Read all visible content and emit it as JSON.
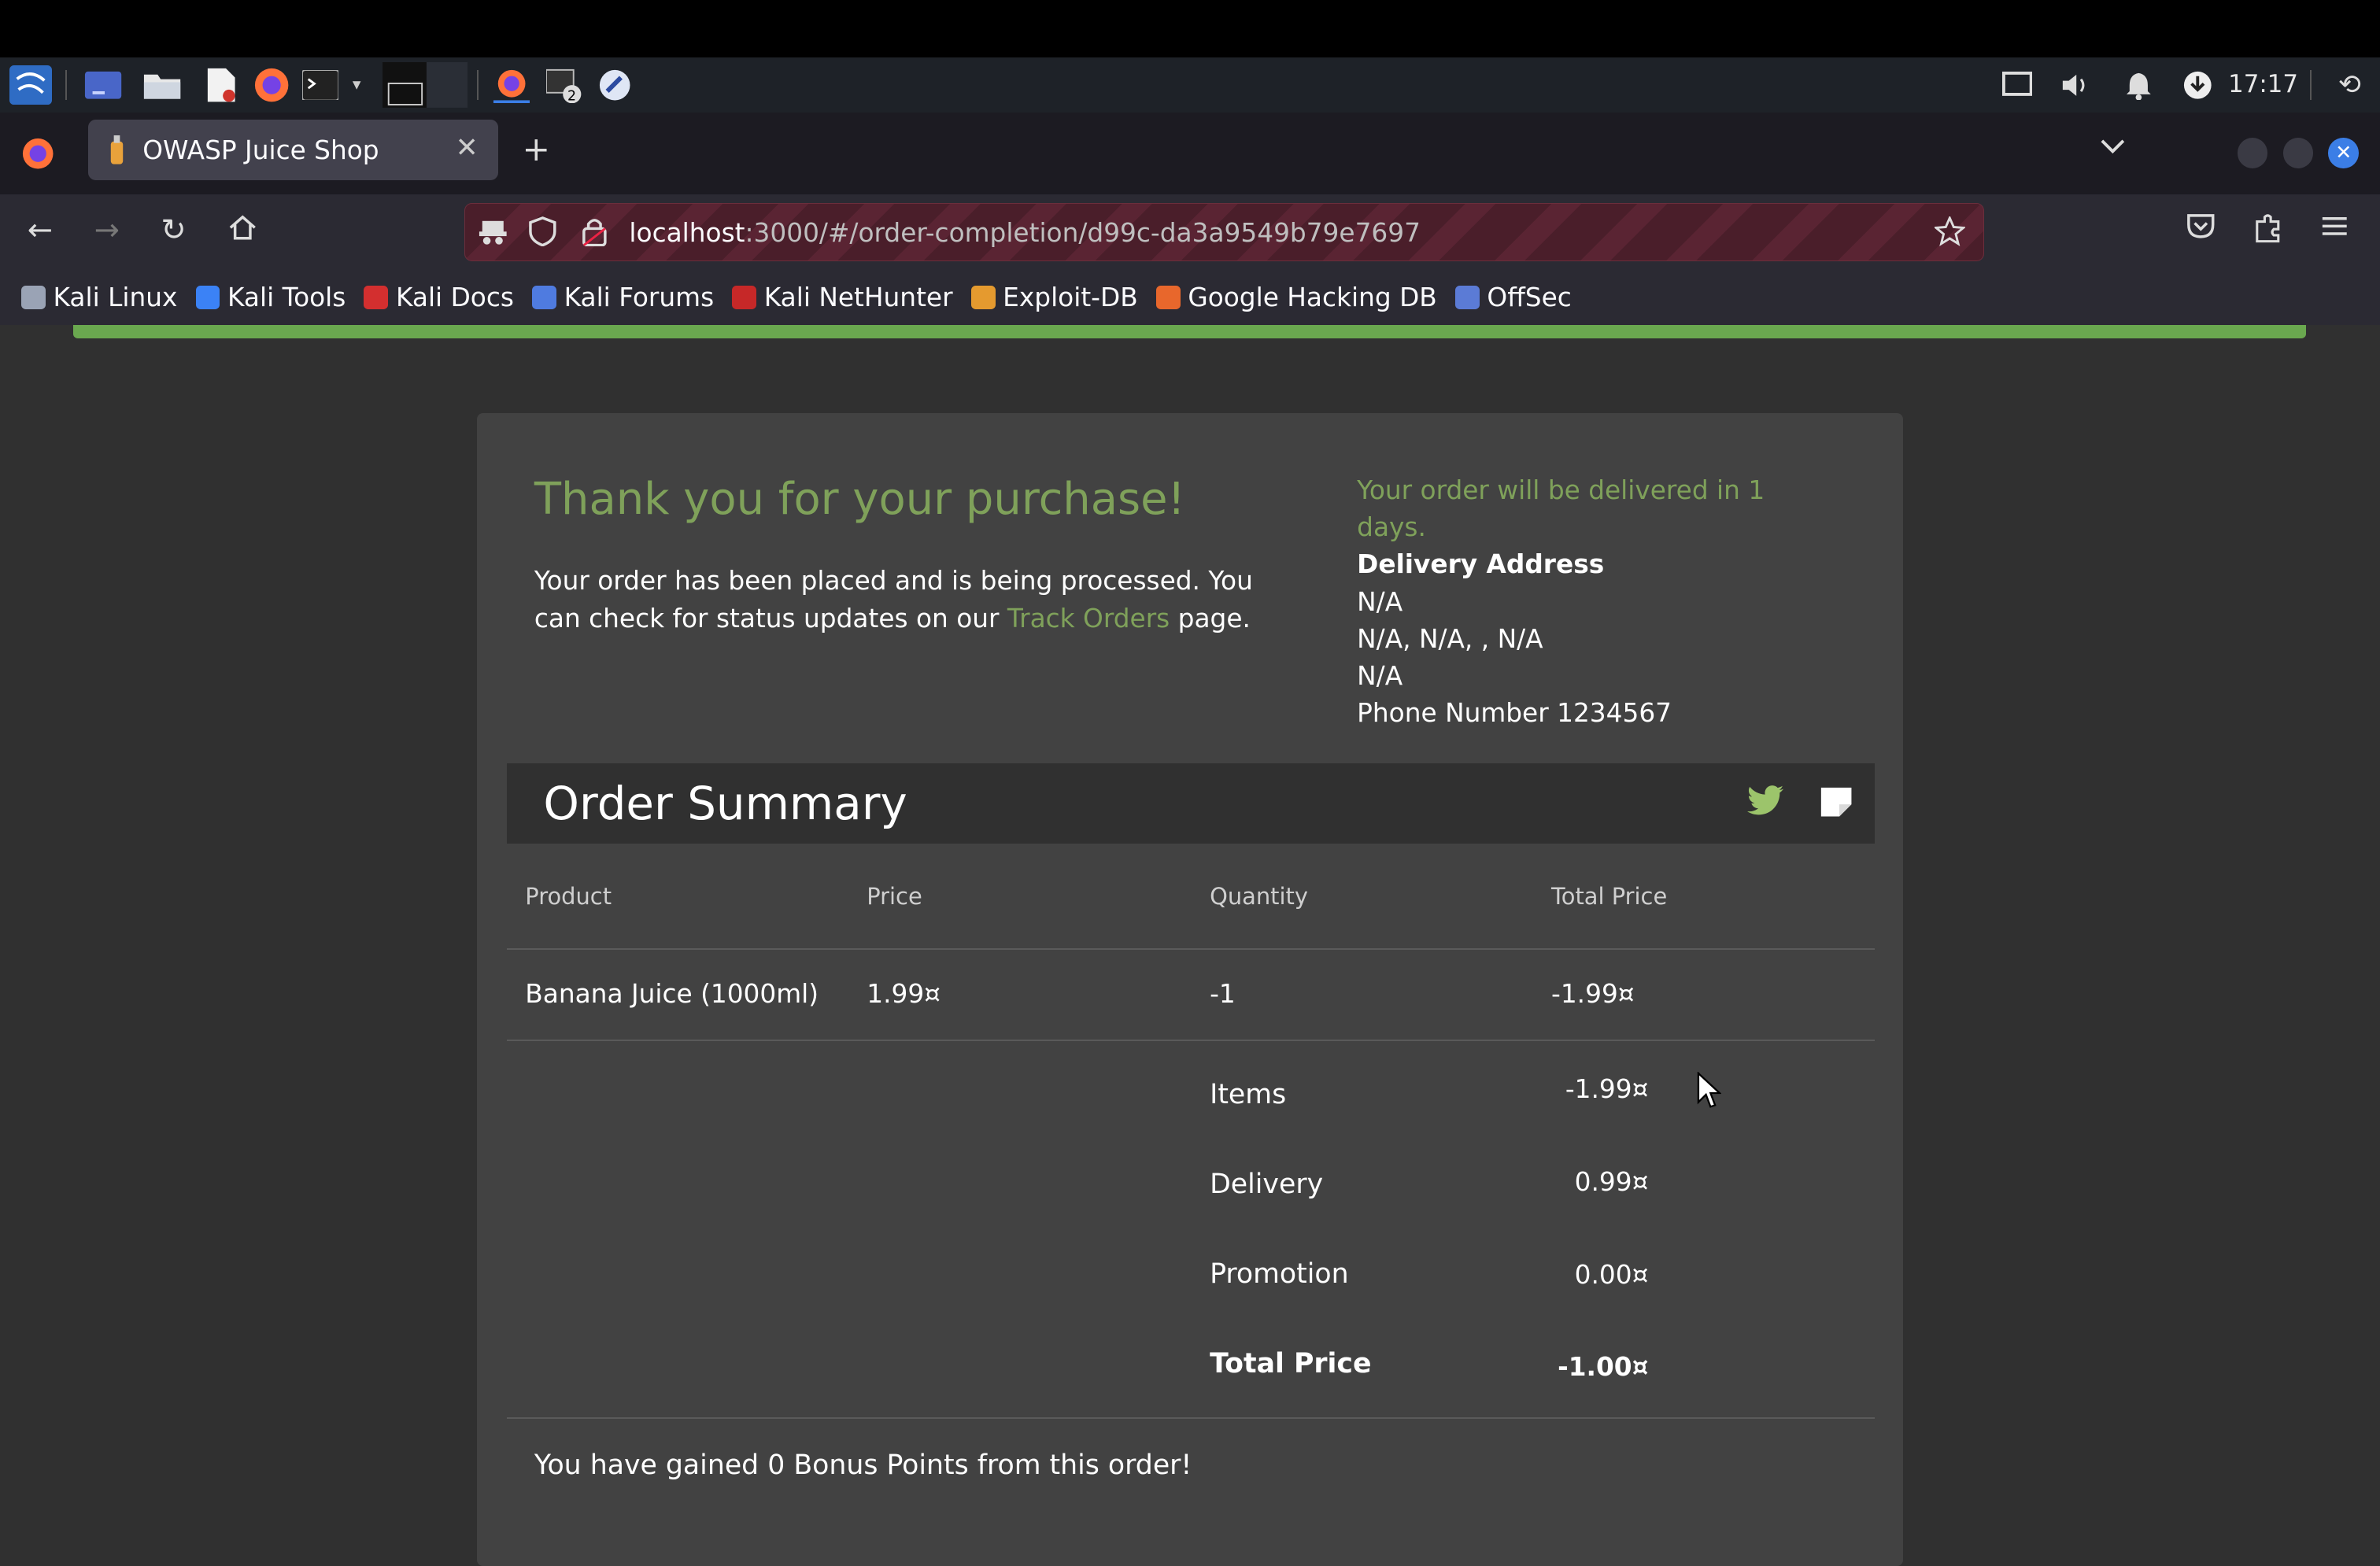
{
  "system": {
    "clock": "17:17"
  },
  "browser": {
    "tab_title": "OWASP Juice Shop",
    "url_host": "localhost",
    "url_rest": ":3000/#/order-completion/d99c-da3a9549b79e7697",
    "bookmarks": [
      "Kali Linux",
      "Kali Tools",
      "Kali Docs",
      "Kali Forums",
      "Kali NetHunter",
      "Exploit-DB",
      "Google Hacking DB",
      "OffSec"
    ],
    "bookmark_colors": [
      "#9aa3b5",
      "#3b82f6",
      "#d32f2f",
      "#4f7be0",
      "#c62828",
      "#e59a2f",
      "#e8672c",
      "#5b7bd6"
    ]
  },
  "page": {
    "thanks": "Thank you for your purchase!",
    "placed_text_1": "Your order has been placed and is being processed. You can check for status updates on our ",
    "track_orders": "Track Orders",
    "placed_text_2": " page.",
    "delivery_eta": "Your order will be delivered in 1 days.",
    "delivery_address_label": "Delivery Address",
    "address_line_1": "N/A",
    "address_line_2": "N/A, N/A, , N/A",
    "address_line_3": "N/A",
    "phone": "Phone Number 1234567",
    "summary_title": "Order Summary",
    "headers": {
      "product": "Product",
      "price": "Price",
      "quantity": "Quantity",
      "total": "Total Price"
    },
    "row": {
      "product": "Banana Juice (1000ml)",
      "price": "1.99¤",
      "quantity": "-1",
      "total": "-1.99¤"
    },
    "totals": {
      "items_label": "Items",
      "items_value": "-1.99¤",
      "delivery_label": "Delivery",
      "delivery_value": "0.99¤",
      "promotion_label": "Promotion",
      "promotion_value": "0.00¤",
      "total_label": "Total Price",
      "total_value": "-1.00¤"
    },
    "bonus": "You have gained 0 Bonus Points from this order!"
  },
  "colors": {
    "accent_green": "#7fa15a",
    "card_bg": "#424242",
    "page_bg": "#303030"
  }
}
